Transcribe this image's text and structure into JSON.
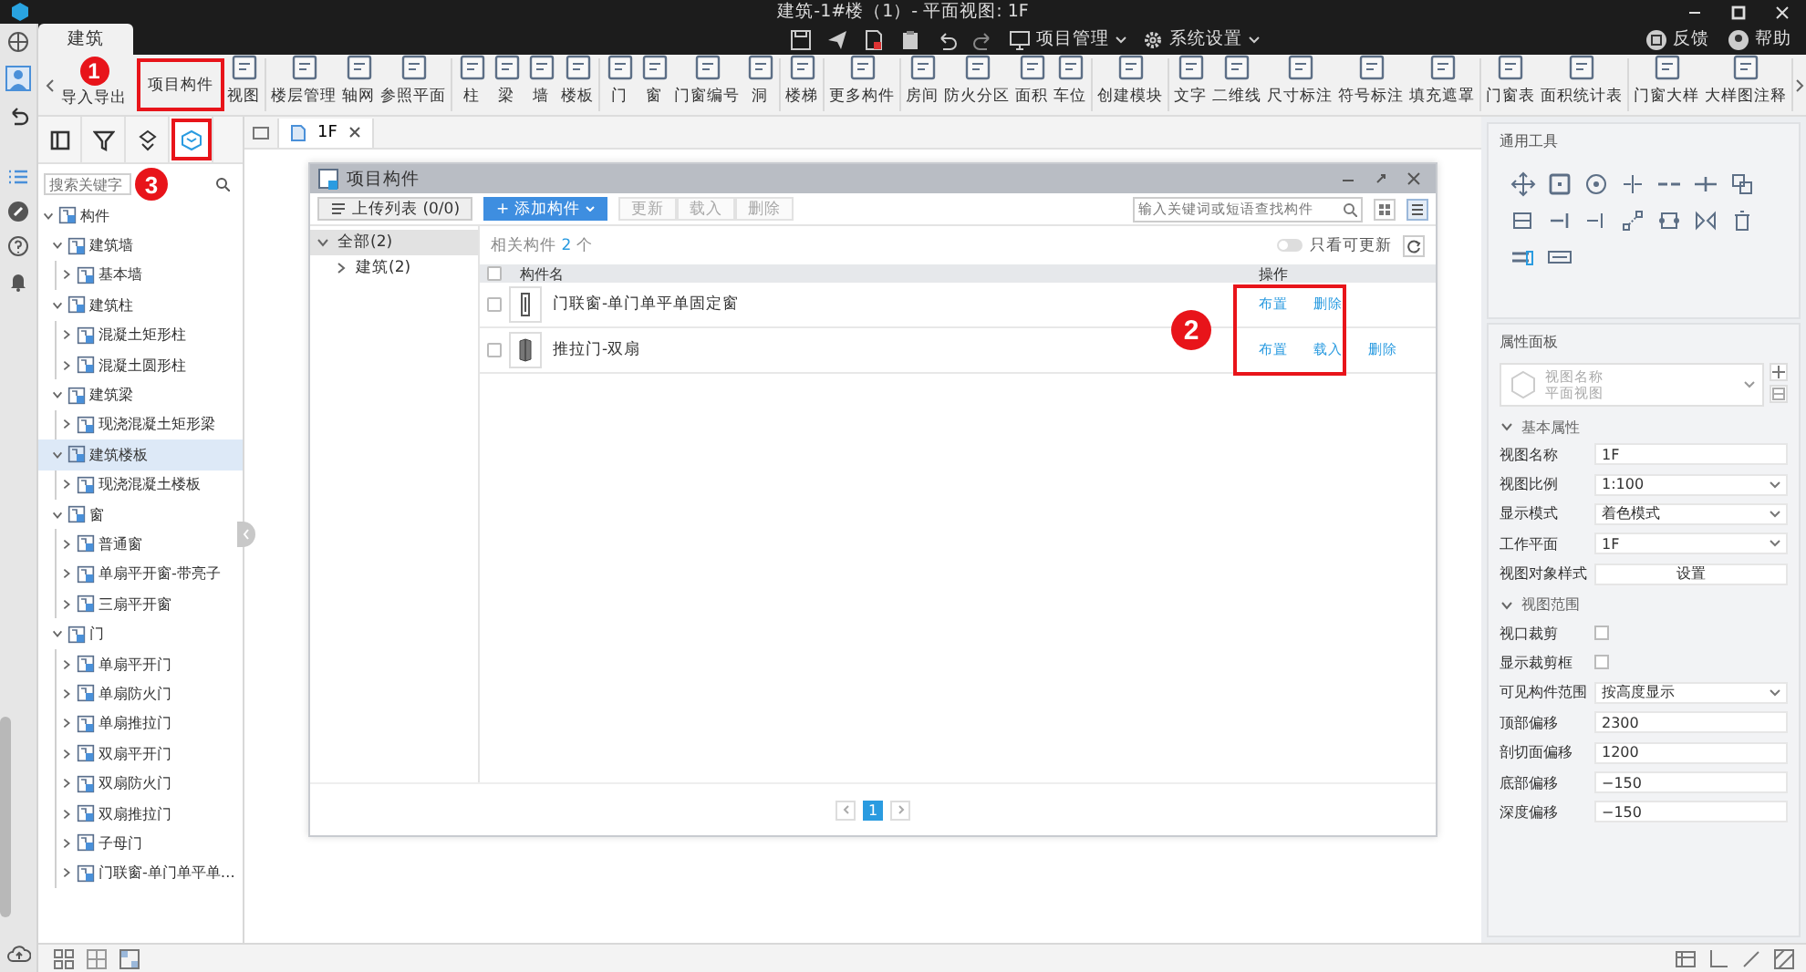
{
  "window": {
    "title": "建筑-1#楼（1）- 平面视图: 1F"
  },
  "menu_tabs": [
    {
      "label": "建筑",
      "selected": true
    }
  ],
  "quick_menus": [
    {
      "label": "项目管理"
    },
    {
      "label": "系统设置"
    }
  ],
  "help_links": [
    {
      "label": "反馈"
    },
    {
      "label": "帮助"
    }
  ],
  "ribbon": {
    "groups": [
      [
        {
          "label": "导入导出",
          "highlighted": false,
          "callout": "1"
        },
        {
          "label": "项目构件",
          "highlighted": true
        },
        {
          "label": "视图",
          "highlighted": false
        }
      ],
      [
        {
          "label": "楼层管理",
          "highlighted": false
        },
        {
          "label": "轴网",
          "highlighted": false
        },
        {
          "label": "参照平面",
          "highlighted": false
        }
      ],
      [
        {
          "label": "柱",
          "highlighted": false
        },
        {
          "label": "梁",
          "highlighted": false
        },
        {
          "label": "墙",
          "highlighted": false
        },
        {
          "label": "楼板",
          "highlighted": false
        }
      ],
      [
        {
          "label": "门",
          "highlighted": false
        },
        {
          "label": "窗",
          "highlighted": false
        },
        {
          "label": "门窗编号",
          "highlighted": false
        },
        {
          "label": "洞",
          "highlighted": false
        }
      ],
      [
        {
          "label": "楼梯",
          "highlighted": false
        }
      ],
      [
        {
          "label": "更多构件",
          "highlighted": false
        }
      ],
      [
        {
          "label": "房间",
          "highlighted": false
        },
        {
          "label": "防火分区",
          "highlighted": false
        },
        {
          "label": "面积",
          "highlighted": false
        },
        {
          "label": "车位",
          "highlighted": false
        }
      ],
      [
        {
          "label": "创建模块",
          "highlighted": false
        }
      ],
      [
        {
          "label": "文字",
          "highlighted": false
        },
        {
          "label": "二维线",
          "highlighted": false
        },
        {
          "label": "尺寸标注",
          "highlighted": false
        },
        {
          "label": "符号标注",
          "highlighted": false
        },
        {
          "label": "填充遮罩",
          "highlighted": false
        }
      ],
      [
        {
          "label": "门窗表",
          "highlighted": false
        },
        {
          "label": "面积统计表",
          "highlighted": false
        }
      ],
      [
        {
          "label": "门窗大样",
          "highlighted": false
        },
        {
          "label": "大样图注释",
          "highlighted": false
        }
      ]
    ]
  },
  "left_panel": {
    "tabs": [
      {
        "selected": false,
        "highlighted": false
      },
      {
        "selected": false,
        "highlighted": false
      },
      {
        "selected": false,
        "highlighted": false
      },
      {
        "selected": true,
        "highlighted": true,
        "callout": "3"
      }
    ],
    "search": {
      "placeholder": "搜索关键字"
    },
    "tree": [
      {
        "label": "构件",
        "expanded": true,
        "selected": false,
        "children": [
          {
            "label": "建筑墙",
            "expanded": true,
            "selected": false,
            "children": [
              {
                "label": "基本墙",
                "expanded": false,
                "selected": false
              }
            ]
          },
          {
            "label": "建筑柱",
            "expanded": true,
            "selected": false,
            "children": [
              {
                "label": "混凝土矩形柱",
                "expanded": false,
                "selected": false
              },
              {
                "label": "混凝土圆形柱",
                "expanded": false,
                "selected": false
              }
            ]
          },
          {
            "label": "建筑梁",
            "expanded": true,
            "selected": false,
            "children": [
              {
                "label": "现浇混凝土矩形梁",
                "expanded": false,
                "selected": false
              }
            ]
          },
          {
            "label": "建筑楼板",
            "expanded": true,
            "selected": true,
            "children": [
              {
                "label": "现浇混凝土楼板",
                "expanded": false,
                "selected": false
              }
            ]
          },
          {
            "label": "窗",
            "expanded": true,
            "selected": false,
            "children": [
              {
                "label": "普通窗",
                "expanded": false,
                "selected": false
              },
              {
                "label": "单扇平开窗-带亮子",
                "expanded": false,
                "selected": false
              },
              {
                "label": "三扇平开窗",
                "expanded": false,
                "selected": false
              }
            ]
          },
          {
            "label": "门",
            "expanded": true,
            "selected": false,
            "children": [
              {
                "label": "单扇平开门",
                "expanded": false,
                "selected": false
              },
              {
                "label": "单扇防火门",
                "expanded": false,
                "selected": false
              },
              {
                "label": "单扇推拉门",
                "expanded": false,
                "selected": false
              },
              {
                "label": "双扇平开门",
                "expanded": false,
                "selected": false
              },
              {
                "label": "双扇防火门",
                "expanded": false,
                "selected": false
              },
              {
                "label": "双扇推拉门",
                "expanded": false,
                "selected": false
              },
              {
                "label": "子母门",
                "expanded": false,
                "selected": false
              },
              {
                "label": "门联窗-单门单平单…",
                "expanded": false,
                "selected": false
              }
            ]
          }
        ]
      }
    ]
  },
  "document_tabs": [
    {
      "label": "1F",
      "selected": true
    }
  ],
  "dialog": {
    "title": "项目构件",
    "upload_button": {
      "label": "上传列表 (0/0)"
    },
    "add_button": {
      "label": "+ 添加构件"
    },
    "actions": [
      {
        "label": "更新",
        "disabled": true
      },
      {
        "label": "载入",
        "disabled": true
      },
      {
        "label": "删除",
        "disabled": true
      }
    ],
    "search": {
      "placeholder": "输入关键词或短语查找构件"
    },
    "view_modes": [
      {
        "selected": false
      },
      {
        "selected": true
      }
    ],
    "categories": [
      {
        "label": "全部(2)",
        "expanded": true,
        "selected": true,
        "children": [
          {
            "label": "建筑(2)",
            "expanded": false,
            "selected": false
          }
        ]
      }
    ],
    "summary": {
      "prefix": "相关构件",
      "count": "2",
      "suffix": "个"
    },
    "filter_toggle": {
      "label": "只看可更新",
      "on": false
    },
    "table": {
      "columns": [
        "构件名",
        "操作"
      ],
      "all_checked": false,
      "actions_highlighted": true,
      "callout": "2",
      "rows": [
        {
          "name": "门联窗-单门单平单固定窗",
          "checked": false,
          "actions": [
            "布置",
            "删除"
          ]
        },
        {
          "name": "推拉门-双扇",
          "checked": false,
          "actions": [
            "布置",
            "载入",
            "删除"
          ]
        }
      ]
    },
    "pagination": {
      "pages": [
        {
          "label": "1",
          "selected": true
        }
      ]
    }
  },
  "tools": {
    "title": "通用工具"
  },
  "properties": {
    "title": "属性面板",
    "view_type": {
      "name": "视图名称",
      "type": "平面视图"
    },
    "sections": [
      {
        "title": "基本属性",
        "expanded": true,
        "rows": [
          {
            "label": "视图名称",
            "kind": "input",
            "value": "1F"
          },
          {
            "label": "视图比例",
            "kind": "select",
            "value": "1:100"
          },
          {
            "label": "显示模式",
            "kind": "select",
            "value": "着色模式"
          },
          {
            "label": "工作平面",
            "kind": "select",
            "value": "1F"
          },
          {
            "label": "视图对象样式",
            "kind": "button",
            "value": "设置"
          }
        ]
      },
      {
        "title": "视图范围",
        "expanded": true,
        "rows": [
          {
            "label": "视口裁剪",
            "kind": "checkbox",
            "checked": false
          },
          {
            "label": "显示裁剪框",
            "kind": "checkbox",
            "checked": false
          },
          {
            "label": "可见构件范围",
            "kind": "select",
            "value": "按高度显示"
          },
          {
            "label": "顶部偏移",
            "kind": "input",
            "value": "2300"
          },
          {
            "label": "剖切面偏移",
            "kind": "input",
            "value": "1200"
          },
          {
            "label": "底部偏移",
            "kind": "input",
            "value": "−150"
          },
          {
            "label": "深度偏移",
            "kind": "input",
            "value": "−150"
          }
        ]
      }
    ]
  }
}
